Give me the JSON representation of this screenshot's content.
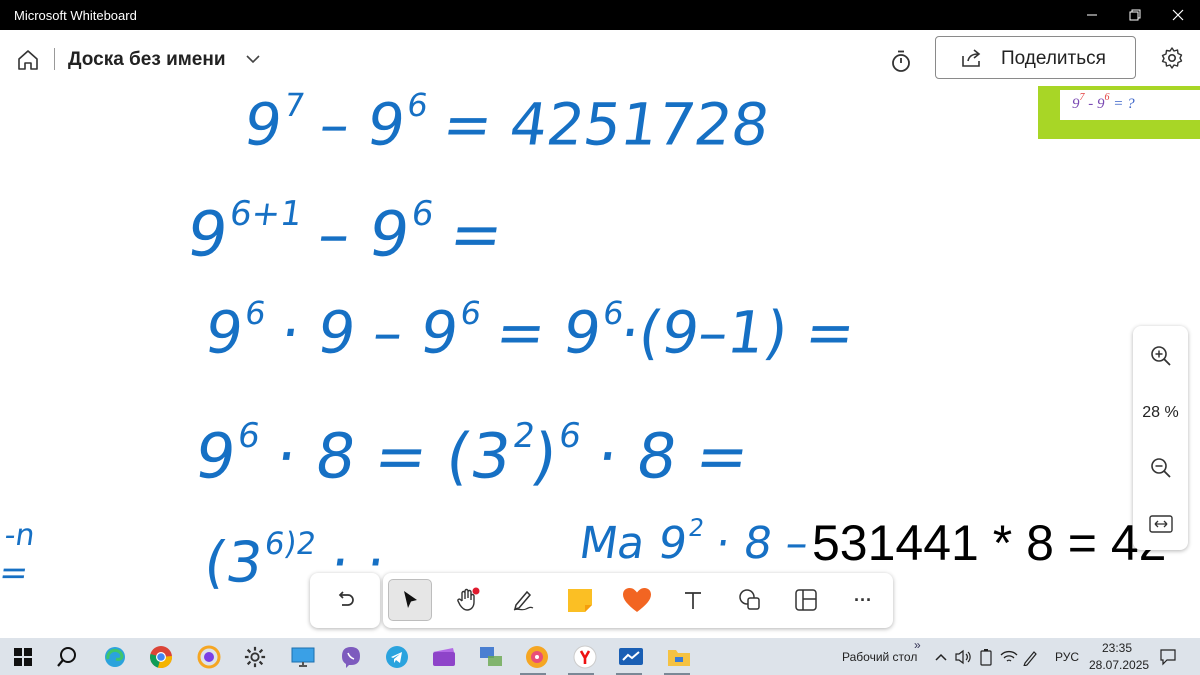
{
  "window": {
    "title": "Microsoft Whiteboard"
  },
  "header": {
    "board_title": "Доска без имени",
    "share_label": "Поделиться"
  },
  "canvas": {
    "ink": {
      "line1": {
        "a": "9",
        "a_exp": "7",
        "b": " – 9",
        "b_exp": "6",
        "c": " = 4251728"
      },
      "line2": {
        "a": "9",
        "a_exp": "6+1",
        "b": " – 9",
        "b_exp": "6",
        "c": " ="
      },
      "line3": {
        "a": "9",
        "a_exp": "6",
        "b": " · 9 – 9",
        "b_exp": "6",
        "c": " =  9",
        "c_exp": "6",
        "d": "·(9–1) ="
      },
      "line4": {
        "a": "9",
        "a_exp": "6",
        "b": " · 8 = (3",
        "b_exp": "2",
        "c": ")",
        "c_exp": "6",
        "d": " · 8 ="
      },
      "line5_right": {
        "a": "Ма 9",
        "a_exp": "2",
        "b": " · 8 –"
      },
      "line5_left": {
        "a": "(3",
        "a_exp": "6)2",
        "b": " ·  ·"
      },
      "left_edge": {
        "a": "-n",
        "b": "="
      }
    },
    "typed_text": "531441 * 8 = 42",
    "sticky": {
      "base1": "9",
      "exp1": "7",
      "minus": " - ",
      "base2": "9",
      "exp2": "6",
      "rest": " = ?"
    }
  },
  "zoom": {
    "level": "28 %"
  },
  "toolbar": {
    "tools": [
      "undo-icon",
      "select-icon",
      "pan-hand-icon",
      "pen-icon",
      "sticky-note-icon",
      "reaction-heart-icon",
      "text-icon",
      "shapes-icon",
      "templates-icon",
      "more-icon"
    ],
    "more_label": "···"
  },
  "taskbar": {
    "desktop_label": "Рабочий стол",
    "lang": "РУС",
    "time": "23:35",
    "date": "28.07.2025",
    "chevron": "»"
  },
  "colors": {
    "ink": "#1670c4",
    "sticky": "#a8d626",
    "heart": "#f26522",
    "sticky_note": "#fbbf24"
  }
}
